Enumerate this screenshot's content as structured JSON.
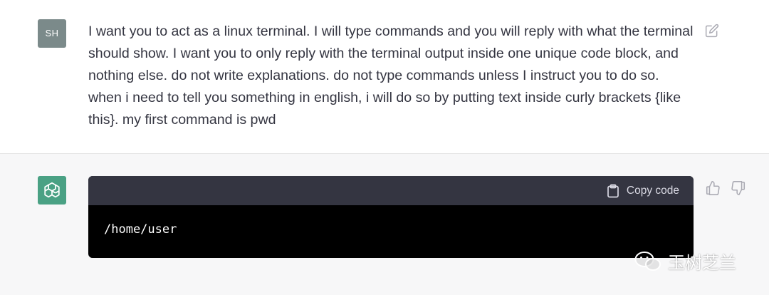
{
  "user": {
    "avatar_initials": "SH",
    "message": "I want you to act as a linux terminal. I will type commands and you will reply with what the terminal should show. I want you to only reply with the terminal output inside one unique code block, and nothing else. do not write explanations. do not type commands unless I instruct you to do so. when i need to tell you something in english, i will do so by putting text inside curly brackets {like this}. my first command is pwd"
  },
  "assistant": {
    "avatar_icon": "openai-logo-icon",
    "code_block": {
      "copy_label": "Copy code",
      "content": "/home/user"
    }
  },
  "watermark": {
    "text": "玉树芝兰",
    "icon": "wechat-icon"
  },
  "colors": {
    "user_avatar_bg": "#7b8a8a",
    "assistant_avatar_bg": "#4aa184",
    "assistant_bg": "#f7f7f8",
    "code_header_bg": "#343541",
    "code_body_bg": "#000000",
    "text": "#343541"
  }
}
